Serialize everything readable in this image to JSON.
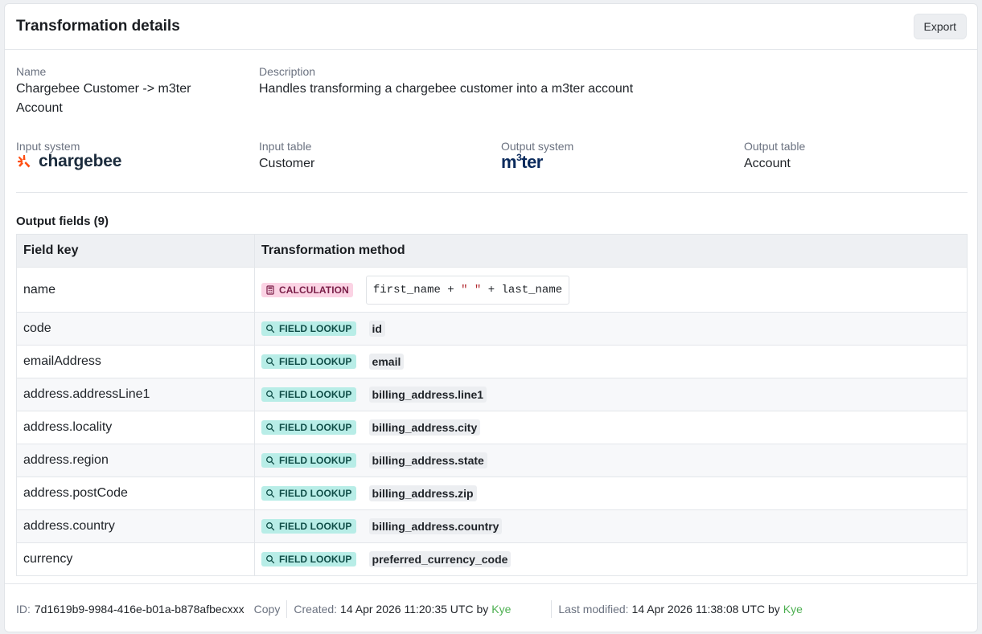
{
  "header": {
    "title": "Transformation details",
    "export_label": "Export"
  },
  "details": {
    "name_label": "Name",
    "name_value": "Chargebee Customer -> m3ter Account",
    "description_label": "Description",
    "description_value": "Handles transforming a chargebee customer into a m3ter account",
    "input_system_label": "Input system",
    "input_system_logo": "chargebee",
    "input_table_label": "Input table",
    "input_table_value": "Customer",
    "output_system_label": "Output system",
    "output_system_logo_main": "m",
    "output_system_logo_sup": "3",
    "output_system_logo_rest": "ter",
    "output_table_label": "Output table",
    "output_table_value": "Account"
  },
  "output_fields": {
    "title": "Output fields (9)",
    "columns": [
      "Field key",
      "Transformation method"
    ],
    "calc_expression": {
      "a": "first_name + ",
      "b": "\" \"",
      "c": " + last_name"
    },
    "rows": [
      {
        "key": "name",
        "method": "CALCULATION",
        "value": ""
      },
      {
        "key": "code",
        "method": "FIELD LOOKUP",
        "value": "id"
      },
      {
        "key": "emailAddress",
        "method": "FIELD LOOKUP",
        "value": "email"
      },
      {
        "key": "address.addressLine1",
        "method": "FIELD LOOKUP",
        "value": "billing_address.line1"
      },
      {
        "key": "address.locality",
        "method": "FIELD LOOKUP",
        "value": "billing_address.city"
      },
      {
        "key": "address.region",
        "method": "FIELD LOOKUP",
        "value": "billing_address.state"
      },
      {
        "key": "address.postCode",
        "method": "FIELD LOOKUP",
        "value": "billing_address.zip"
      },
      {
        "key": "address.country",
        "method": "FIELD LOOKUP",
        "value": "billing_address.country"
      },
      {
        "key": "currency",
        "method": "FIELD LOOKUP",
        "value": "preferred_currency_code"
      }
    ]
  },
  "footer": {
    "id_label": "ID:",
    "id_value": "7d1619b9-9984-416e-b01a-b878afbecxxx",
    "copy_label": "Copy",
    "created_label": "Created:",
    "created_value": "14 Apr 2026 11:20:35 UTC by",
    "created_by": "Kye",
    "modified_label": "Last modified:",
    "modified_value": "14 Apr 2026 11:38:08 UTC by",
    "modified_by": "Kye"
  },
  "colors": {
    "calc_badge": "#fbd3e4",
    "lookup_badge": "#b8ede7",
    "link": "#4caf50",
    "chargebee_orange": "#ff4f14"
  },
  "icons": {
    "calculation": "calculator-icon",
    "lookup": "search-icon"
  }
}
